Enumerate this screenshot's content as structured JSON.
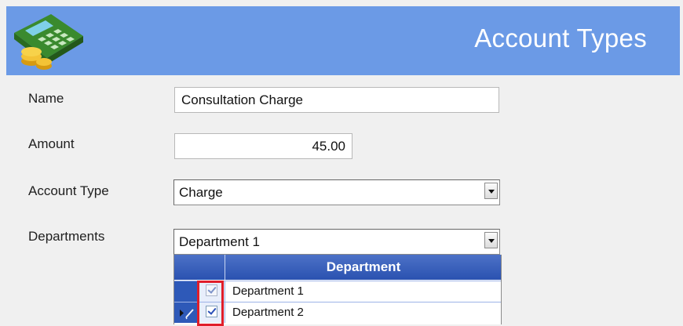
{
  "header": {
    "title": "Account Types",
    "logo_icon": "calculator-coins-icon"
  },
  "form": {
    "name_label": "Name",
    "name_value": "Consultation Charge",
    "amount_label": "Amount",
    "amount_value": "45.00",
    "account_type_label": "Account Type",
    "account_type_value": "Charge",
    "departments_label": "Departments",
    "departments_value": "Department 1"
  },
  "department_grid": {
    "column_header": "Department",
    "rows": [
      {
        "label": "Department 1",
        "checked": true
      },
      {
        "label": "Department 2",
        "checked": true,
        "editing": true
      }
    ]
  },
  "colors": {
    "header_bg": "#6b9ae6",
    "grid_header_bg": "#2a52b0",
    "highlight_border": "#e01e2a"
  }
}
